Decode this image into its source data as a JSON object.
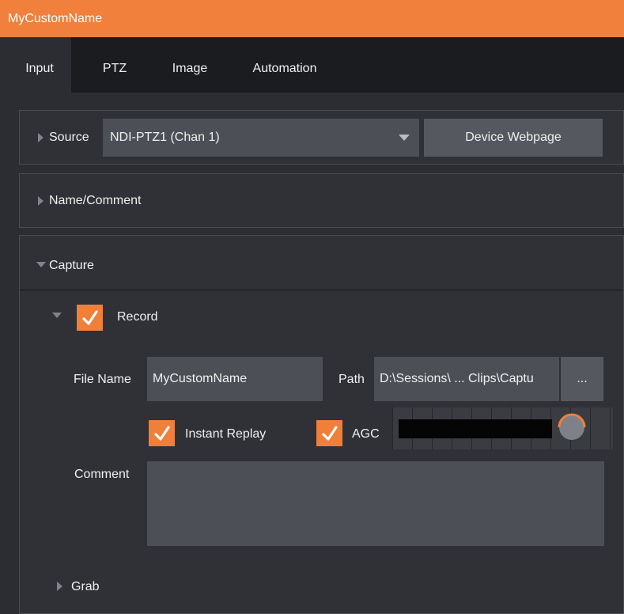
{
  "window": {
    "title": "MyCustomName"
  },
  "tabs": [
    {
      "label": "Input",
      "active": true
    },
    {
      "label": "PTZ",
      "active": false
    },
    {
      "label": "Image",
      "active": false
    },
    {
      "label": "Automation",
      "active": false
    }
  ],
  "source": {
    "label": "Source",
    "selected": "NDI-PTZ1 (Chan 1)",
    "webpage_button": "Device Webpage"
  },
  "name_comment": {
    "label": "Name/Comment"
  },
  "capture": {
    "label": "Capture",
    "record": {
      "label": "Record",
      "checked": true
    },
    "file_name": {
      "label": "File Name",
      "value": "MyCustomName"
    },
    "path": {
      "label": "Path",
      "value": "D:\\Sessions\\ ... Clips\\Captu",
      "browse_label": "..."
    },
    "instant_replay": {
      "label": "Instant Replay",
      "checked": true
    },
    "agc": {
      "label": "AGC",
      "checked": true
    },
    "comment": {
      "label": "Comment",
      "value": ""
    },
    "grab": {
      "label": "Grab"
    }
  },
  "colors": {
    "accent": "#f0803c",
    "background": "#2b2d32",
    "tabbar": "#1b1c20",
    "field": "#4c4f55",
    "button": "#55585e"
  },
  "icons": {
    "collapsed": "triangle-right-icon",
    "expanded": "triangle-down-icon",
    "dropdown": "caret-down-icon",
    "checkbox": "checkmark-icon",
    "volume": "volume-knob-icon"
  }
}
